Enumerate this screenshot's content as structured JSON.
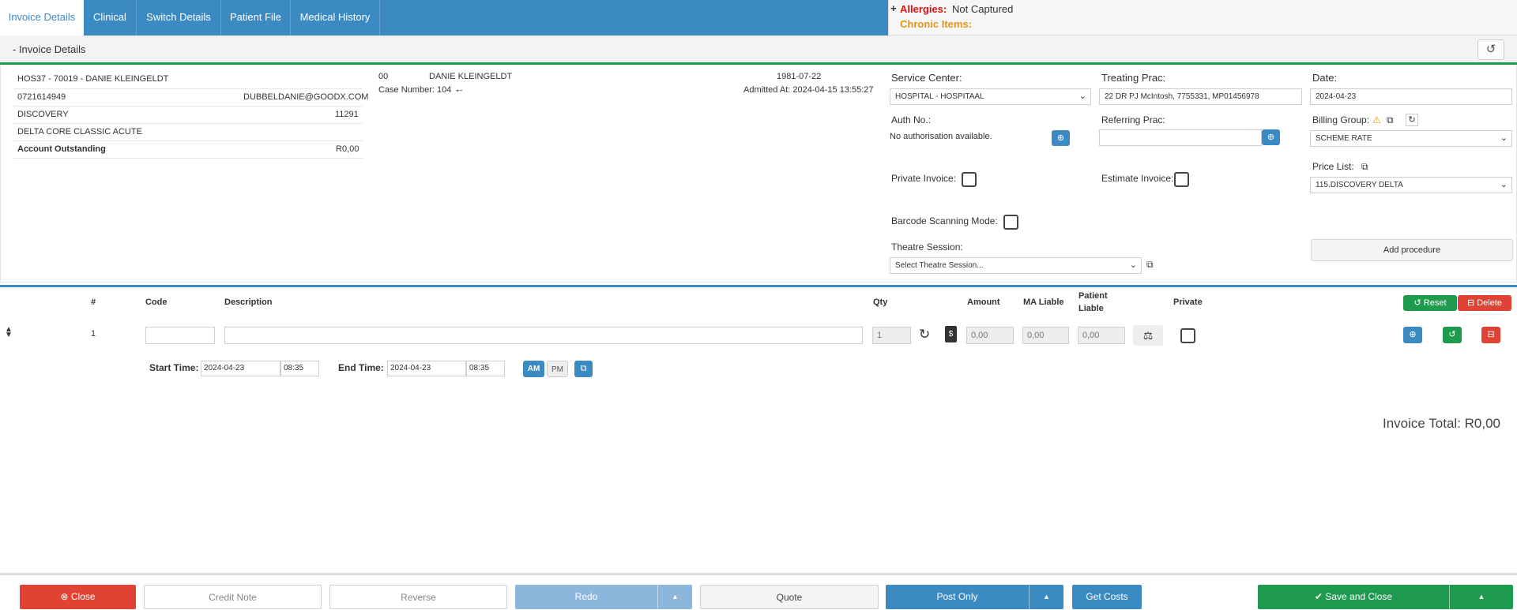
{
  "tabs": [
    "Invoice Details",
    "Clinical",
    "Switch Details",
    "Patient File",
    "Medical History"
  ],
  "alerts": {
    "plus": "+",
    "allergies_label": "Allergies:",
    "allergies_value": "Not Captured",
    "chronic_label": "Chronic Items:"
  },
  "section": {
    "title": "- Invoice Details"
  },
  "patient": {
    "account_line": "HOS37 -  70019  -  DANIE KLEINGELDT",
    "phone": "0721614949",
    "email": "DUBBELDANIE@GOODX.COM",
    "medical_aid": "DISCOVERY",
    "medical_aid_no": "11291",
    "plan": "DELTA CORE CLASSIC ACUTE",
    "outstanding_label": "Account Outstanding",
    "outstanding_value": "R0,00",
    "dep_code": "00",
    "name": "DANIE KLEINGELDT",
    "case_number": "Case Number: 104",
    "dob": "1981-07-22",
    "admitted": "Admitted At: 2024-04-15 13:55:27"
  },
  "form": {
    "service_center_label": "Service Center:",
    "service_center_value": "HOSPITAL - HOSPITAAL",
    "treating_prac_label": "Treating Prac:",
    "treating_prac_value": "22 DR PJ McIntosh, 7755331, MP01456978",
    "date_label": "Date:",
    "date_value": "2024-04-23",
    "auth_label": "Auth No.:",
    "auth_value": "No authorisation available.",
    "referring_prac_label": "Referring Prac:",
    "billing_group_label": "Billing Group:",
    "billing_group_value": "SCHEME RATE",
    "price_list_label": "Price List:",
    "price_list_value": "115.DISCOVERY DELTA",
    "private_invoice_label": "Private Invoice:",
    "estimate_invoice_label": "Estimate Invoice:",
    "barcode_label": "Barcode Scanning Mode:",
    "theatre_label": "Theatre Session:",
    "theatre_value": "Select Theatre Session...",
    "add_procedure": "Add procedure"
  },
  "lines": {
    "headers": {
      "num": "#",
      "code": "Code",
      "description": "Description",
      "qty": "Qty",
      "amount": "Amount",
      "ma_liable": "MA Liable",
      "patient_liable_1": "Patient",
      "patient_liable_2": "Liable",
      "private": "Private"
    },
    "reset": "Reset",
    "delete": "Delete",
    "row": {
      "num": "1",
      "qty": "1",
      "amount": "0,00",
      "ma_liable": "0,00",
      "patient_liable": "0,00"
    },
    "start_time_label": "Start Time:",
    "start_date": "2024-04-23",
    "start_time": "08:35",
    "end_time_label": "End Time:",
    "end_date": "2024-04-23",
    "end_time": "08:35",
    "am": "AM",
    "pm": "PM"
  },
  "totals": {
    "invoice_total": "Invoice Total: R0,00"
  },
  "footer": {
    "close": "Close",
    "credit_note": "Credit Note",
    "reverse": "Reverse",
    "redo": "Redo",
    "quote": "Quote",
    "post_only": "Post Only",
    "get_costs": "Get Costs",
    "save_and_close": "Save and Close"
  },
  "colors": {
    "primary": "#3b8ac2",
    "success": "#1e9b4e",
    "danger": "#e04234",
    "warning": "#e5951a"
  }
}
